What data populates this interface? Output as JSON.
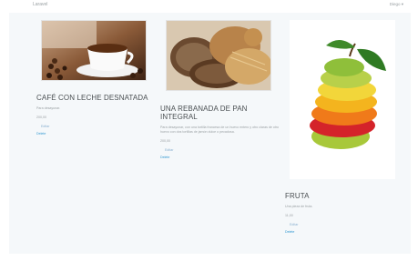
{
  "navbar": {
    "brand": "Laravel",
    "user": "Diego ▾"
  },
  "products": [
    {
      "name": "CAFÉ CON LECHE DESNATADA",
      "description": "Para desayunar.",
      "price": "200,00",
      "edit": "Editar",
      "delete": "Delete"
    },
    {
      "name": "UNA REBANADA DE PAN INTEGRAL",
      "description": "Para desayunar, con una tortilla francesa de un huevo entero y otro claras de otro huevo con dos tortillas de jamón dulce o pecadosa.",
      "price": "200,00",
      "edit": "Editar",
      "delete": "Delete"
    },
    {
      "name": "FRUTA",
      "description": "Una pieza de fruta.",
      "price": "11,00",
      "edit": "Editar",
      "delete": "Delete"
    }
  ]
}
